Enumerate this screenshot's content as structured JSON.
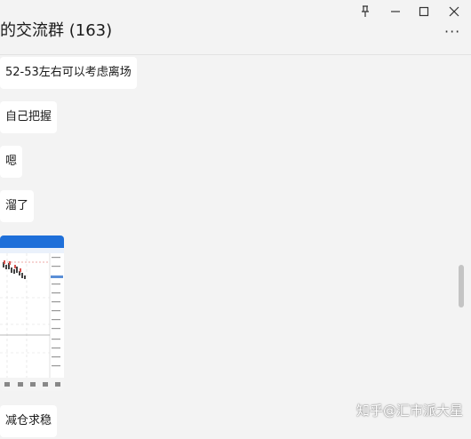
{
  "header": {
    "title": "的交流群 (163)",
    "more_label": "···"
  },
  "window_controls": [
    "pin-icon",
    "minimize-icon",
    "maximize-icon",
    "close-icon"
  ],
  "messages": [
    {
      "text": "52-53左右可以考虑离场"
    },
    {
      "text": "自己把握"
    },
    {
      "text": "嗯"
    },
    {
      "text": "溜了"
    },
    {
      "text": "减仓求稳"
    }
  ],
  "watermark": "知乎@汇市派大星",
  "colors": {
    "accent": "#1e6fd9",
    "background": "#f3f3f3",
    "bubble": "#ffffff"
  }
}
